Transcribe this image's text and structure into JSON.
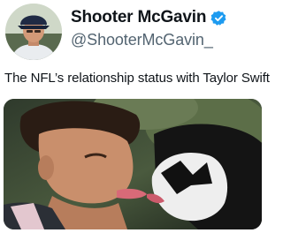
{
  "tweet": {
    "author": {
      "display_name": "Shooter McGavin",
      "handle": "@ShooterMcGavin_",
      "verified": true,
      "avatar_icon": "avatar-photo"
    },
    "text": "The NFL’s relationship status with Taylor Swift",
    "media": {
      "type": "image",
      "icon": "movie-still-photo"
    }
  },
  "colors": {
    "text_primary": "#0f1419",
    "text_secondary": "#536471",
    "verified_blue": "#1d9bf0",
    "background": "#ffffff"
  }
}
